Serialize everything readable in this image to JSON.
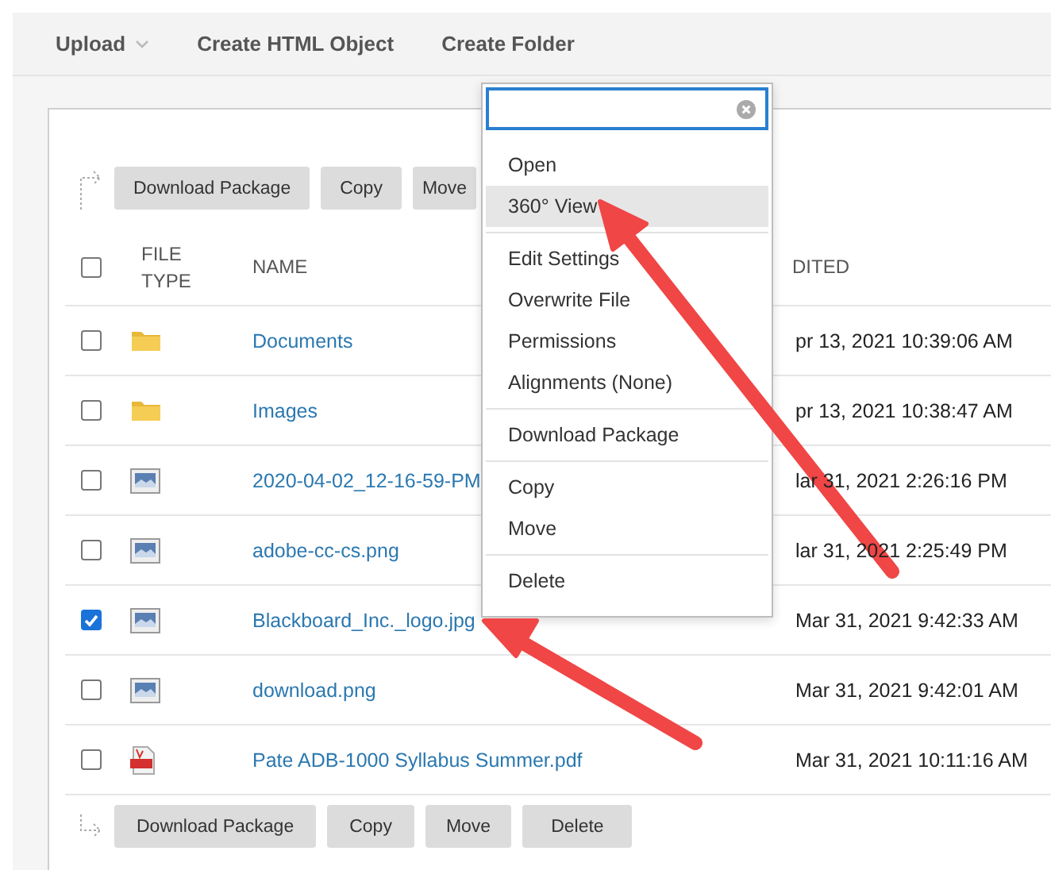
{
  "toolbar": [
    {
      "label": "Upload",
      "has_menu": true
    },
    {
      "label": "Create HTML Object",
      "has_menu": false
    },
    {
      "label": "Create Folder",
      "has_menu": false
    }
  ],
  "top_actions": [
    "Download Package",
    "Copy",
    "Move"
  ],
  "table": {
    "header_checked": false,
    "columns": [
      "FILE TYPE",
      "NAME",
      "DITED"
    ],
    "rows": [
      {
        "checked": false,
        "kind": "folder",
        "name": "Documents",
        "edited": "pr 13, 2021 10:39:06 AM"
      },
      {
        "checked": false,
        "kind": "folder",
        "name": "Images",
        "edited": "pr 13, 2021 10:38:47 AM"
      },
      {
        "checked": false,
        "kind": "image",
        "name": "2020-04-02_12-16-59-PM",
        "edited": "lar 31, 2021 2:26:16 PM"
      },
      {
        "checked": false,
        "kind": "image",
        "name": "adobe-cc-cs.png",
        "edited": "lar 31, 2021 2:25:49 PM"
      },
      {
        "checked": true,
        "kind": "image",
        "name": "Blackboard_Inc._logo.jpg",
        "edited": "Mar 31, 2021 9:42:33 AM"
      },
      {
        "checked": false,
        "kind": "image",
        "name": "download.png",
        "edited": "Mar 31, 2021 9:42:01 AM"
      },
      {
        "checked": false,
        "kind": "pdf",
        "name": "Pate ADB-1000 Syllabus Summer.pdf",
        "edited": "Mar 31, 2021 10:11:16 AM"
      }
    ]
  },
  "bottom_actions": [
    "Download Package",
    "Copy",
    "Move",
    "Delete"
  ],
  "context_menu": {
    "groups": [
      [
        {
          "label": "Open",
          "selected": false
        },
        {
          "label": "360° View",
          "selected": true
        }
      ],
      [
        {
          "label": "Edit Settings",
          "selected": false
        },
        {
          "label": "Overwrite File",
          "selected": false
        },
        {
          "label": "Permissions",
          "selected": false
        },
        {
          "label": "Alignments (None)",
          "selected": false
        }
      ],
      [
        {
          "label": "Download Package",
          "selected": false
        }
      ],
      [
        {
          "label": "Copy",
          "selected": false
        },
        {
          "label": "Move",
          "selected": false
        }
      ],
      [
        {
          "label": "Delete",
          "selected": false
        }
      ]
    ]
  }
}
